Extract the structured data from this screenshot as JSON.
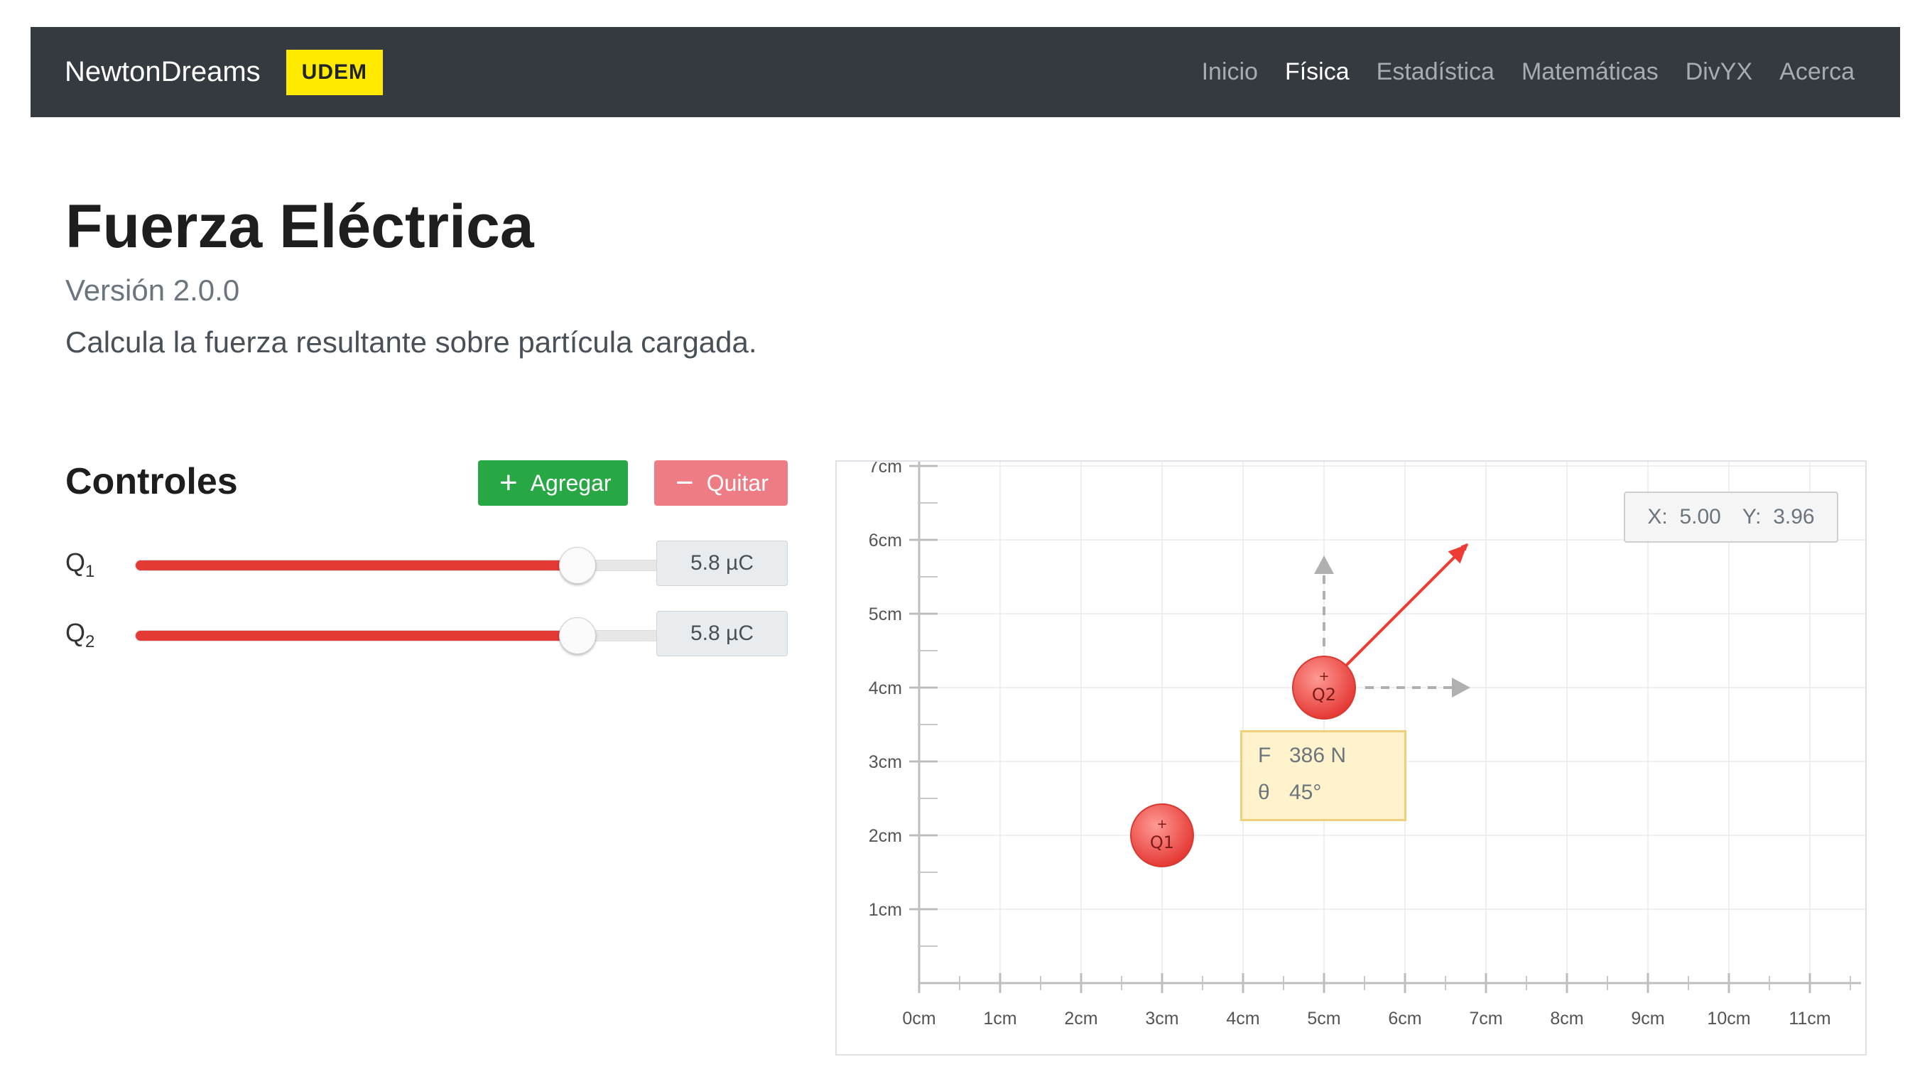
{
  "navbar": {
    "brand": "NewtonDreams",
    "badge": "UDEM",
    "links": [
      {
        "label": "Inicio",
        "active": false
      },
      {
        "label": "Física",
        "active": true
      },
      {
        "label": "Estadística",
        "active": false
      },
      {
        "label": "Matemáticas",
        "active": false
      },
      {
        "label": "DivYX",
        "active": false
      },
      {
        "label": "Acerca",
        "active": false
      }
    ]
  },
  "header": {
    "title": "Fuerza Eléctrica",
    "version": "Versión 2.0.0",
    "description": "Calcula la fuerza resultante sobre partícula cargada."
  },
  "controls": {
    "title": "Controles",
    "add_label": "Agregar",
    "add_icon": "plus-icon",
    "remove_label": "Quitar",
    "remove_icon": "minus-icon",
    "sliders": [
      {
        "label": "Q",
        "sub": "1",
        "value": "5.8 µC",
        "fraction": 0.8
      },
      {
        "label": "Q",
        "sub": "2",
        "value": "5.8 µC",
        "fraction": 0.8
      }
    ]
  },
  "colors": {
    "navbar": "#343a40",
    "badge": "#ffea00",
    "add": "#28a745",
    "remove": "#ee7c85",
    "slider_fill": "#e53935",
    "charge": "#e53935",
    "force_vector": "#ee3b33",
    "component_arrows": "#b0b0b0"
  },
  "plot": {
    "coords": {
      "x_label": "X:",
      "x_value": "5.00",
      "y_label": "Y:",
      "y_value": "3.96"
    },
    "x_ticks": [
      "0cm",
      "1cm",
      "2cm",
      "3cm",
      "4cm",
      "5cm",
      "6cm",
      "7cm",
      "8cm",
      "9cm",
      "10cm",
      "11cm"
    ],
    "y_ticks": [
      "1cm",
      "2cm",
      "3cm",
      "4cm",
      "5cm",
      "6cm",
      "7cm"
    ],
    "charges": [
      {
        "name": "Q1",
        "sign": "+",
        "x": 3,
        "y": 2
      },
      {
        "name": "Q2",
        "sign": "+",
        "x": 5,
        "y": 4
      }
    ],
    "force": {
      "f_label": "F",
      "f_value": "386 N",
      "theta_label": "θ",
      "theta_value": "45°",
      "angle_deg": 45
    }
  }
}
